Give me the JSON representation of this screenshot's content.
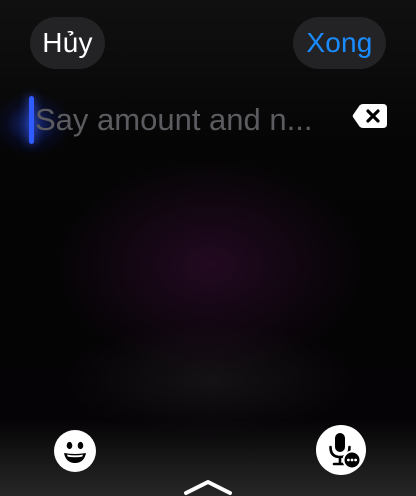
{
  "header": {
    "cancel_label": "Hủy",
    "done_label": "Xong"
  },
  "input": {
    "placeholder": "Say amount and n..."
  },
  "icons": {
    "delete": "delete-backward-icon",
    "emoji": "smiley-face-icon",
    "dictation": "microphone-dictation-icon",
    "expand": "chevron-up-icon"
  },
  "colors": {
    "accent": "#1a8cff",
    "cursor": "#2f5bff",
    "placeholder": "#5c5c60",
    "button_background": "#232325"
  }
}
